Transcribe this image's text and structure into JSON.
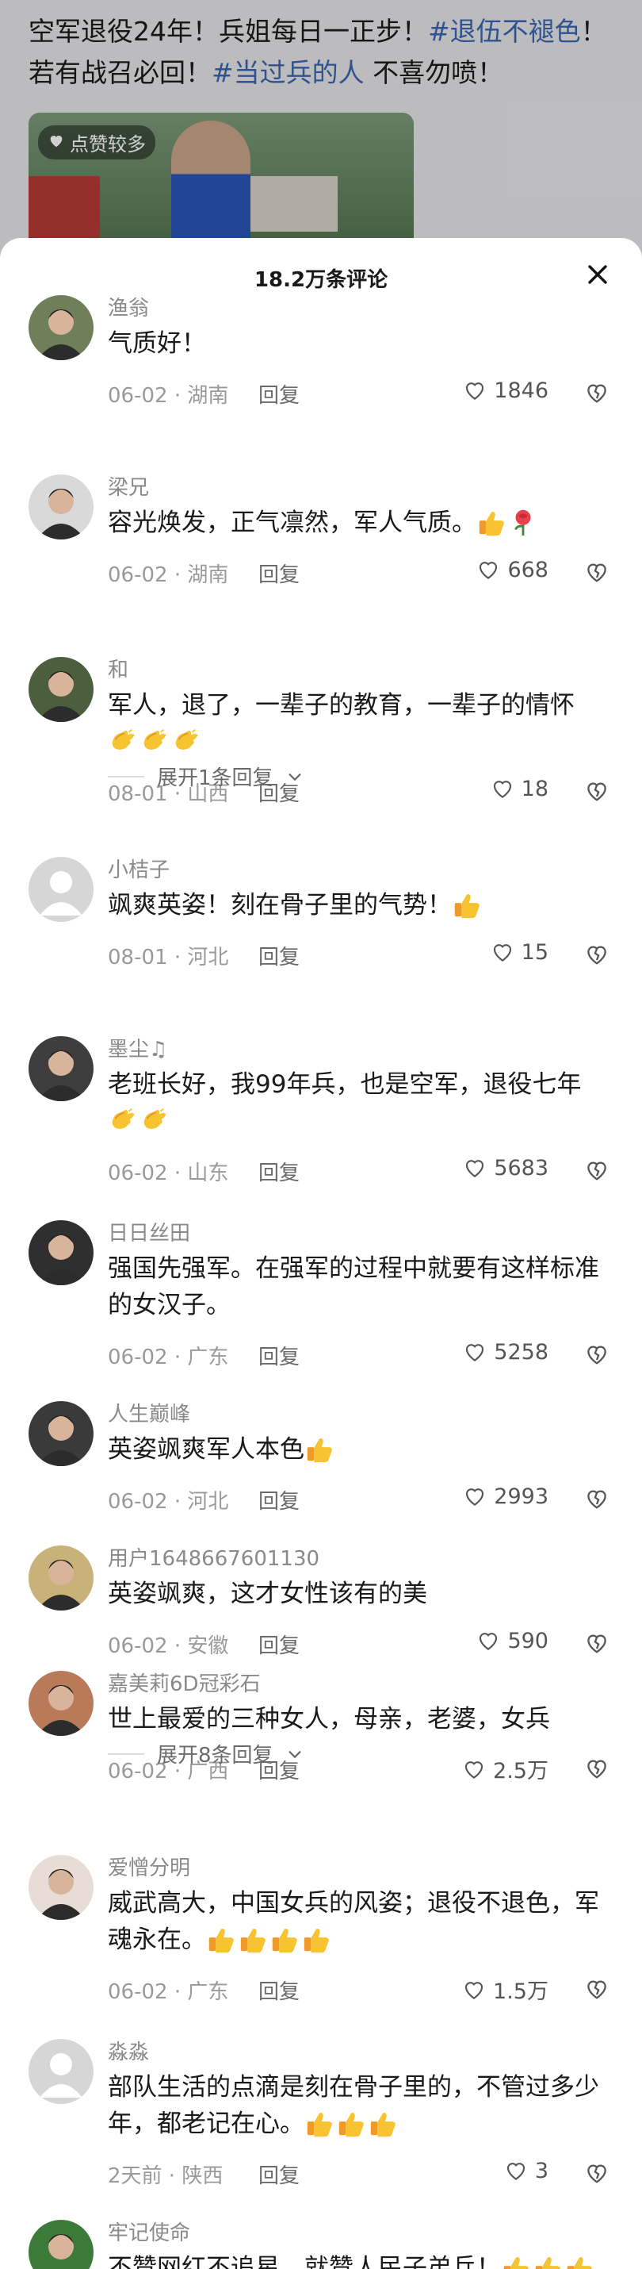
{
  "post": {
    "text_prefix": "空军退役24年！兵姐每日一正步！",
    "tag1": "#退伍不褪色",
    "text_mid": "！若有战召必回！",
    "tag2": "#当过兵的人",
    "text_suffix": " 不喜勿喷！",
    "photo_badge": "点赞较多"
  },
  "sheet": {
    "title": "18.2万条评论"
  },
  "comments": [
    {
      "user": "渔翁",
      "text": "气质好！",
      "date": "06-02",
      "region": "湖南",
      "reply": "回复",
      "likes": "1846",
      "avatar_color": "#6f7f5a"
    },
    {
      "user": "梁兄",
      "text": "容光焕发，正气凛然，军人气质。",
      "date": "06-02",
      "region": "湖南",
      "reply": "回复",
      "likes": "668",
      "avatar_color": "#d9d9d9",
      "emojis": [
        "thumb",
        "rose"
      ]
    },
    {
      "user": "和",
      "text": "军人，退了，一辈子的教育，一辈子的情怀",
      "date": "08-01",
      "region": "山西",
      "reply": "回复",
      "likes": "18",
      "avatar_color": "#4b5f3f",
      "emojis": [
        "clap",
        "clap",
        "clap"
      ]
    },
    {
      "user": "小桔子",
      "text": "飒爽英姿！刻在骨子里的气势！",
      "date": "08-01",
      "region": "河北",
      "reply": "回复",
      "likes": "15",
      "avatar_color": "#d4d4d4",
      "emojis": [
        "thumb"
      ]
    },
    {
      "user": "墨尘♫",
      "text": "老班长好，我99年兵，也是空军，退役七年",
      "date": "06-02",
      "region": "山东",
      "reply": "回复",
      "likes": "5683",
      "avatar_color": "#3e3e3e",
      "emojis": [
        "clap",
        "clap"
      ]
    },
    {
      "user": "日日丝田",
      "text": "强国先强军。在强军的过程中就要有这样标准的女汉子。",
      "date": "06-02",
      "region": "广东",
      "reply": "回复",
      "likes": "5258",
      "avatar_color": "#2f2f2f"
    },
    {
      "user": "人生巅峰",
      "text": "英姿飒爽军人本色",
      "date": "06-02",
      "region": "河北",
      "reply": "回复",
      "likes": "2993",
      "avatar_color": "#3a3a3a",
      "emojis": [
        "thumb"
      ]
    },
    {
      "user": "用户1648667601130",
      "text": "英姿飒爽，这才女性该有的美",
      "date": "06-02",
      "region": "安徽",
      "reply": "回复",
      "likes": "590",
      "avatar_color": "#c9b27a"
    },
    {
      "user": "嘉美莉6D冠彩石",
      "text": "世上最爱的三种女人，母亲，老婆，女兵",
      "date": "06-02",
      "region": "广西",
      "reply": "回复",
      "likes": "2.5万",
      "avatar_color": "#b87a58"
    },
    {
      "user": "爱憎分明",
      "text": "威武高大，中国女兵的风姿；退役不退色，军魂永在。",
      "date": "06-02",
      "region": "广东",
      "reply": "回复",
      "likes": "1.5万",
      "avatar_color": "#e8dcd6",
      "emojis": [
        "thumb",
        "thumb",
        "thumb",
        "thumb"
      ]
    },
    {
      "user": "淼淼",
      "text": "部队生活的点滴是刻在骨子里的，不管过多少年，都老记在心。",
      "date": "2天前",
      "region": "陕西",
      "reply": "回复",
      "likes": "3",
      "avatar_color": "#d4d4d4",
      "emojis": [
        "thumb",
        "thumb",
        "thumb"
      ]
    },
    {
      "user": "牢记使命",
      "text": "不赞网红不追星，就赞人民子弟兵！",
      "date": "",
      "region": "",
      "reply": "",
      "likes": "",
      "avatar_color": "#3c7a3a",
      "emojis": [
        "thumb",
        "thumb",
        "thumb"
      ]
    }
  ],
  "expand": {
    "after_2": "展开1条回复",
    "after_8": "展开8条回复"
  }
}
